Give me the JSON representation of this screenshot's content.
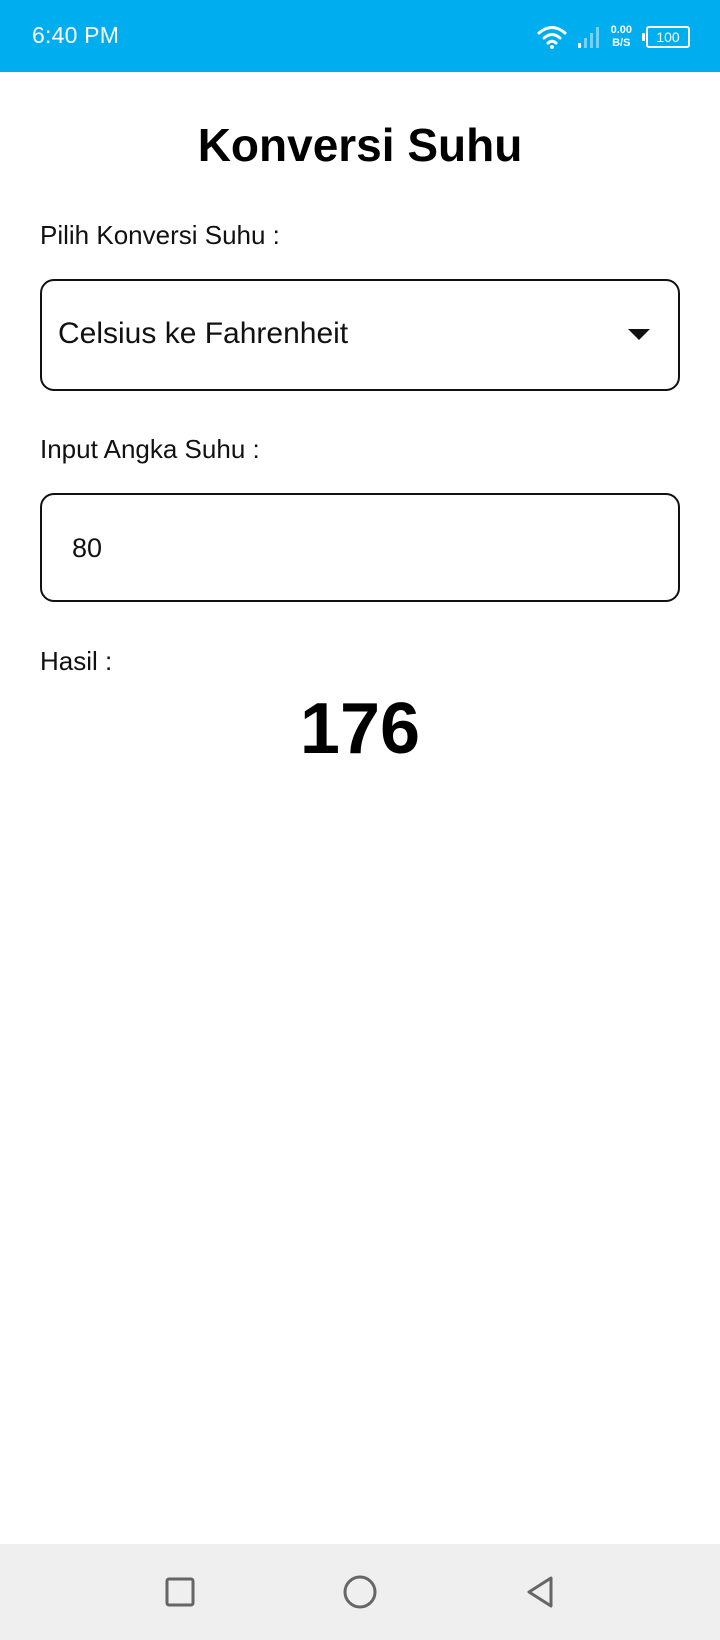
{
  "status_bar": {
    "time": "6:40 PM",
    "net_speed_value": "0.00",
    "net_speed_unit": "B/S",
    "battery": "100",
    "icons": [
      "wifi-icon",
      "signal-icon",
      "battery-icon"
    ],
    "background_color": "#00aeef"
  },
  "app": {
    "title": "Konversi Suhu",
    "conversion_label": "Pilih Konversi Suhu :",
    "conversion_selected": "Celsius ke Fahrenheit",
    "input_label": "Input Angka Suhu :",
    "input_value": "80",
    "result_label": "Hasil :",
    "result_value": "176"
  },
  "nav_bar": {
    "icons": [
      "recent-apps-icon",
      "home-icon",
      "back-icon"
    ]
  }
}
